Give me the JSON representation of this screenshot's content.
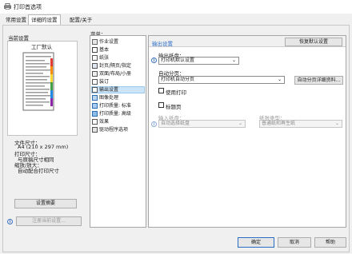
{
  "window": {
    "title": "打印首选项"
  },
  "tabs": [
    {
      "label": "常用设置"
    },
    {
      "label": "详细的设置"
    },
    {
      "label": "配置/关于"
    }
  ],
  "left": {
    "current_settings_label": "当前设置",
    "preview_title": "工厂默认",
    "file_size_label": "文件尺寸：",
    "file_size_value": "A4 (210 x 297 mm)",
    "print_size_label": "打印尺寸：",
    "print_size_value": "与原稿尺寸相同",
    "zoom_label": "缩放/放大：",
    "zoom_value": "自动配合打印尺寸",
    "settings_summary_button": "设置摘要",
    "register_button": "注册当前设置..."
  },
  "menu": {
    "label": "菜单：",
    "items": [
      {
        "label": "作业设置"
      },
      {
        "label": "基本"
      },
      {
        "label": "纸张"
      },
      {
        "label": "封页/隔页/指定"
      },
      {
        "label": "双面/布局/小册"
      },
      {
        "label": "装订"
      },
      {
        "label": "输出设置"
      },
      {
        "label": "图像处理"
      },
      {
        "label": "打印质量: 标准"
      },
      {
        "label": "打印质量: 高级"
      },
      {
        "label": "效果"
      },
      {
        "label": "驱动程序选项"
      }
    ],
    "selected": "输出设置"
  },
  "right": {
    "section_title": "输出设置",
    "restore_button": "恢复默认设置",
    "output_tray_label": "输出纸盘：",
    "output_tray_value": "打印机默认设置",
    "auto_sort_label": "自动分页：",
    "auto_sort_value": "打印机自动分页",
    "auto_sort_details_button": "自动分页详细资料...",
    "use_print_label": "使用打印",
    "banner_label": "标题页",
    "input_tray_label": "输入纸盘：",
    "input_tray_value": "自动选择纸盘",
    "paper_type_label": "纸张类型：",
    "paper_type_value": "普通纸和再生纸"
  },
  "footer": {
    "ok": "确定",
    "cancel": "取消",
    "help": "帮助"
  }
}
